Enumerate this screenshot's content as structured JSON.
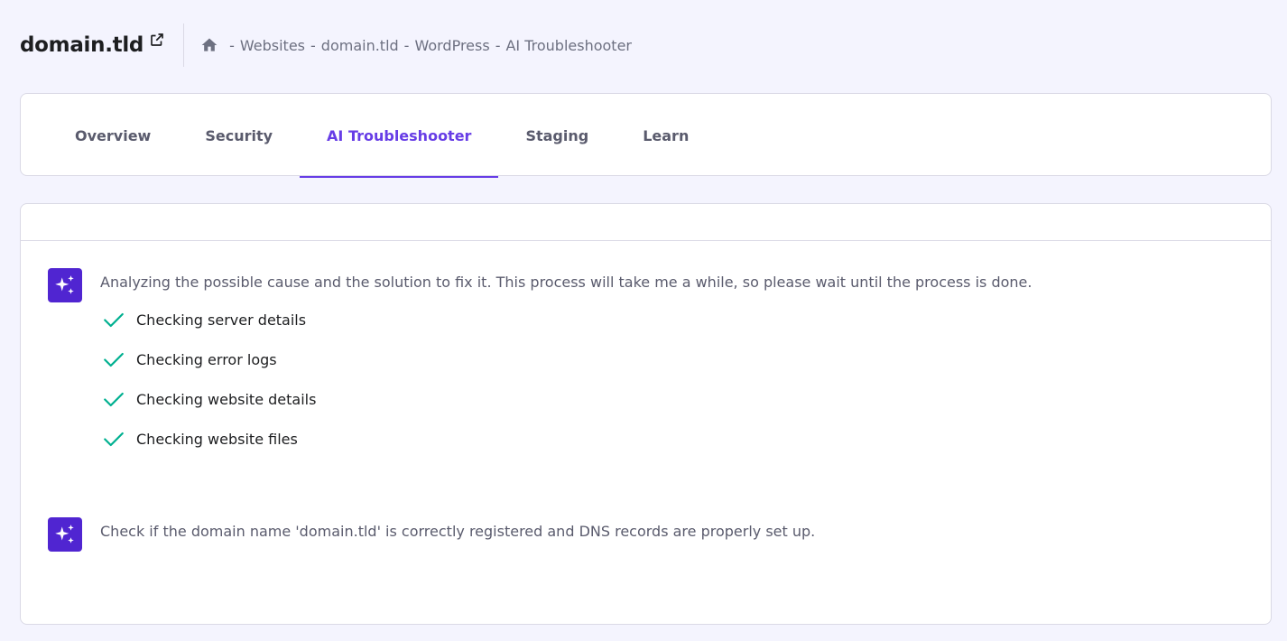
{
  "header": {
    "site_title": "domain.tld",
    "breadcrumb": [
      "Websites",
      "domain.tld",
      "WordPress",
      "AI Troubleshooter"
    ],
    "breadcrumb_separator": "-"
  },
  "tabs": [
    {
      "label": "Overview",
      "active": false
    },
    {
      "label": "Security",
      "active": false
    },
    {
      "label": "AI Troubleshooter",
      "active": true
    },
    {
      "label": "Staging",
      "active": false
    },
    {
      "label": "Learn",
      "active": false
    }
  ],
  "messages": {
    "analysis": {
      "text": "Analyzing the possible cause and the solution to fix it. This process will take me a while, so please wait until the process is done.",
      "checks": [
        "Checking server details",
        "Checking error logs",
        "Checking website details",
        "Checking website files"
      ]
    },
    "result": {
      "text": "Check if the domain name 'domain.tld' is correctly registered and DNS records are properly set up."
    }
  },
  "colors": {
    "accent": "#673de6",
    "avatar": "#5025d1",
    "check": "#00b090",
    "background": "#f4f4fe"
  }
}
